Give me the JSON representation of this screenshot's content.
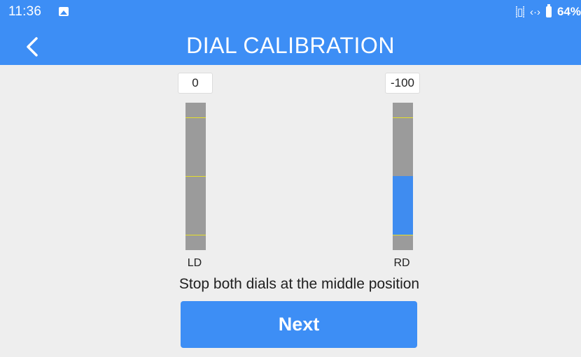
{
  "status_bar": {
    "time": "11:36",
    "battery_percent": "64%",
    "icons": [
      "gallery-icon",
      "vibrate-icon",
      "data-icon",
      "battery-icon"
    ]
  },
  "header": {
    "title": "DIAL CALIBRATION",
    "background_color": "#3d8ef5"
  },
  "dials": [
    {
      "label": "LD",
      "value": "0"
    },
    {
      "label": "RD",
      "value": "-100"
    }
  ],
  "instruction": "Stop both dials at the middle position",
  "next_button": {
    "label": "Next"
  },
  "colors": {
    "accent": "#3d8ef5",
    "track": "#9b9b9b",
    "tick": "#e6df2a",
    "background": "#eeeeee"
  }
}
